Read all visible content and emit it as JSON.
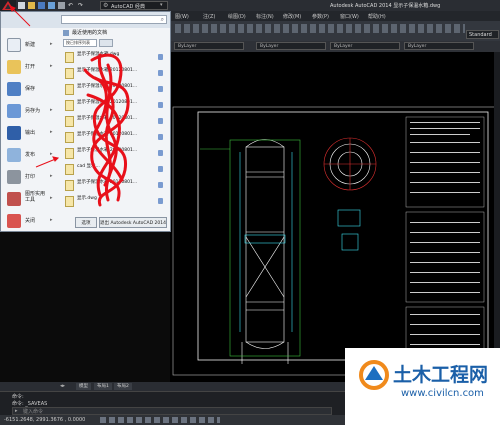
{
  "window": {
    "title": "Autodesk AutoCAD 2014    显示子保温水箱.dwg",
    "workspace": "AutoCAD 经典",
    "help_label": "Standard"
  },
  "menubar": {
    "items": [
      "图(W)",
      "注(Z)",
      "绘图(D)",
      "标注(N)",
      "修改(M)",
      "参数(P)",
      "窗口(W)",
      "帮助(H)"
    ]
  },
  "properties": {
    "layer": "ByLayer",
    "linetype": "ByLayer",
    "lineweight": "ByLayer",
    "color": "ByLayer"
  },
  "app_menu": {
    "search_placeholder": "",
    "recent_header": "最近使用的文档",
    "sort_label": "按已排序列表",
    "left_items": [
      {
        "label": "新建",
        "icon": "new-file-icon"
      },
      {
        "label": "打开",
        "icon": "open-folder-icon"
      },
      {
        "label": "保存",
        "icon": "save-icon"
      },
      {
        "label": "另存为",
        "icon": "save-as-icon"
      },
      {
        "label": "输出",
        "icon": "export-icon"
      },
      {
        "label": "发布",
        "icon": "publish-icon"
      },
      {
        "label": "打印",
        "icon": "print-icon"
      },
      {
        "label": "图形实用工具",
        "icon": "drawing-utilities-icon"
      },
      {
        "label": "关闭",
        "icon": "close-file-icon"
      }
    ],
    "recent_docs": [
      "显示子保温水箱.dwg",
      "显示子保温水箱 20120801...",
      "显示子保温水箱 20120801...",
      "显示子保温水箱 20120801...",
      "显示子保温水箱 20120801...",
      "显示子保温水箱 20120801...",
      "显示子保温水箱 20120801...",
      "cad 显示...",
      "显示子保温水箱 20120801...",
      "显示.dwg"
    ],
    "options_button": "选项",
    "exit_button": "退出 Autodesk AutoCAD 2014"
  },
  "layout_tabs": [
    "模型",
    "布局1",
    "布局2"
  ],
  "command": {
    "history": "命令:",
    "prompt_history": "命令:  _SAVEAS",
    "input_placeholder": "键入命令"
  },
  "status": {
    "coords": "-6151.2648,  2991.3676 ,  0.0000"
  },
  "watermark": {
    "brand": "土木工程网",
    "url": "www.civilcn.com"
  },
  "colors": {
    "red_scribble": "#e8101a",
    "accent_blue": "#1c6fc0",
    "drawing_white": "#ffffff",
    "drawing_cyan": "#3de0f0",
    "drawing_green": "#3ec03e",
    "drawing_yellow": "#e8e020",
    "drawing_red": "#e03030"
  }
}
